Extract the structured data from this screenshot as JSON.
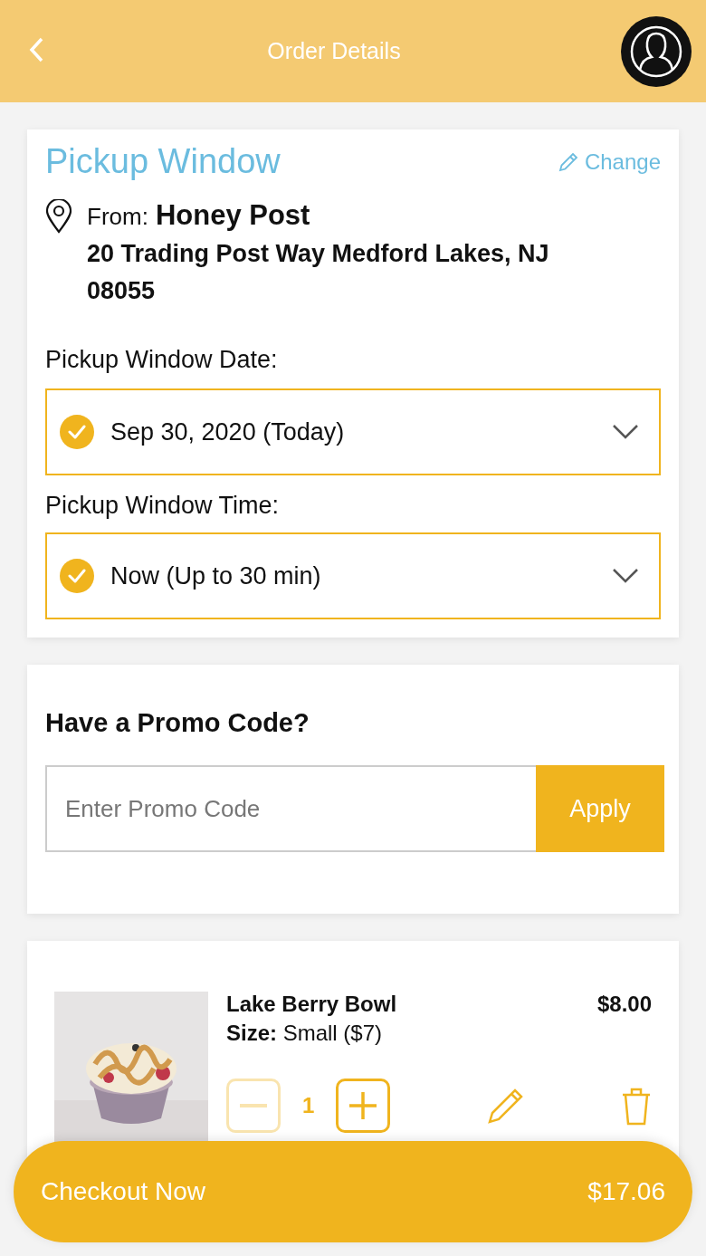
{
  "header": {
    "title": "Order Details"
  },
  "pickup": {
    "title": "Pickup Window",
    "change_label": "Change",
    "from_label": "From:",
    "store_name": "Honey Post",
    "address": "20 Trading Post Way Medford Lakes, NJ 08055",
    "fields": [
      {
        "label": "Pickup Window Date:",
        "value": "Sep 30, 2020 (Today)",
        "checked": true
      },
      {
        "label": "Pickup Window Time:",
        "value": "Now (Up to 30 min)",
        "checked": true
      }
    ]
  },
  "promo": {
    "title": "Have a Promo Code?",
    "placeholder": "Enter Promo Code",
    "button": "Apply"
  },
  "items": [
    {
      "name": "Lake Berry Bowl",
      "size_label": "Size:",
      "size": "Small ($7)",
      "price": "$8.00",
      "quantity": "1",
      "decrease_disabled": true
    }
  ],
  "checkout": {
    "label": "Checkout Now",
    "total": "$17.06"
  }
}
